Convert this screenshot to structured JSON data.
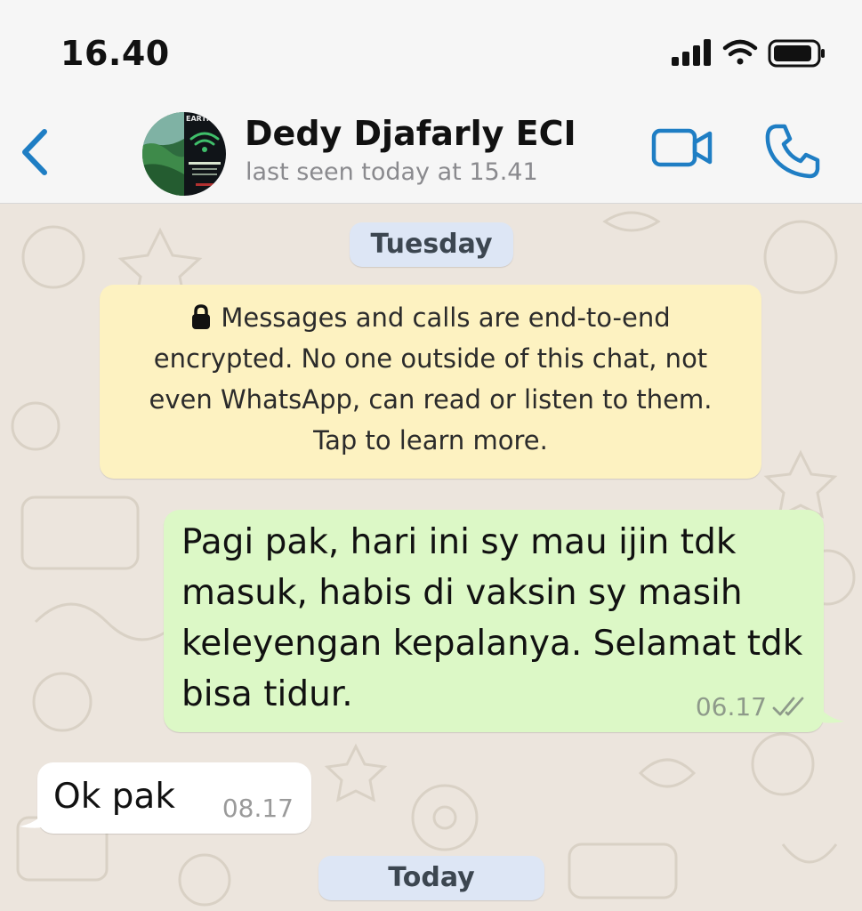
{
  "status_bar": {
    "time": "16.40"
  },
  "header": {
    "contact_name": "Dedy Djafarly ECI",
    "last_seen": "last seen today at 15.41",
    "avatar_caption": "EARTH"
  },
  "chat": {
    "date_separators": [
      "Tuesday",
      "Today"
    ],
    "encryption_notice": {
      "lines": [
        "Messages and calls are end-to-end",
        "encrypted. No one outside of this chat, not",
        "even WhatsApp, can read or listen to them.",
        "Tap to learn more."
      ]
    },
    "messages": [
      {
        "direction": "outgoing",
        "lines": [
          "Pagi pak, hari ini sy mau ijin tdk",
          "masuk, habis di vaksin sy masih",
          "keleyengan kepalanya. Selamat tdk",
          "bisa tidur."
        ],
        "time": "06.17",
        "status": "read"
      },
      {
        "direction": "incoming",
        "text": "Ok pak",
        "time": "08.17"
      }
    ]
  },
  "colors": {
    "accent": "#1f7ec4",
    "outgoing_bubble": "#dcf8c6",
    "incoming_bubble": "#ffffff",
    "notice_bg": "#fdf2c1",
    "date_pill_bg": "#dde6f5",
    "chat_bg": "#ece5dd"
  },
  "icons": {
    "back": "chevron-left-icon",
    "video": "video-camera-icon",
    "phone": "phone-icon",
    "lock": "lock-icon",
    "ticks": "double-check-icon",
    "signal": "signal-bars-icon",
    "wifi": "wifi-icon",
    "battery": "battery-icon"
  }
}
